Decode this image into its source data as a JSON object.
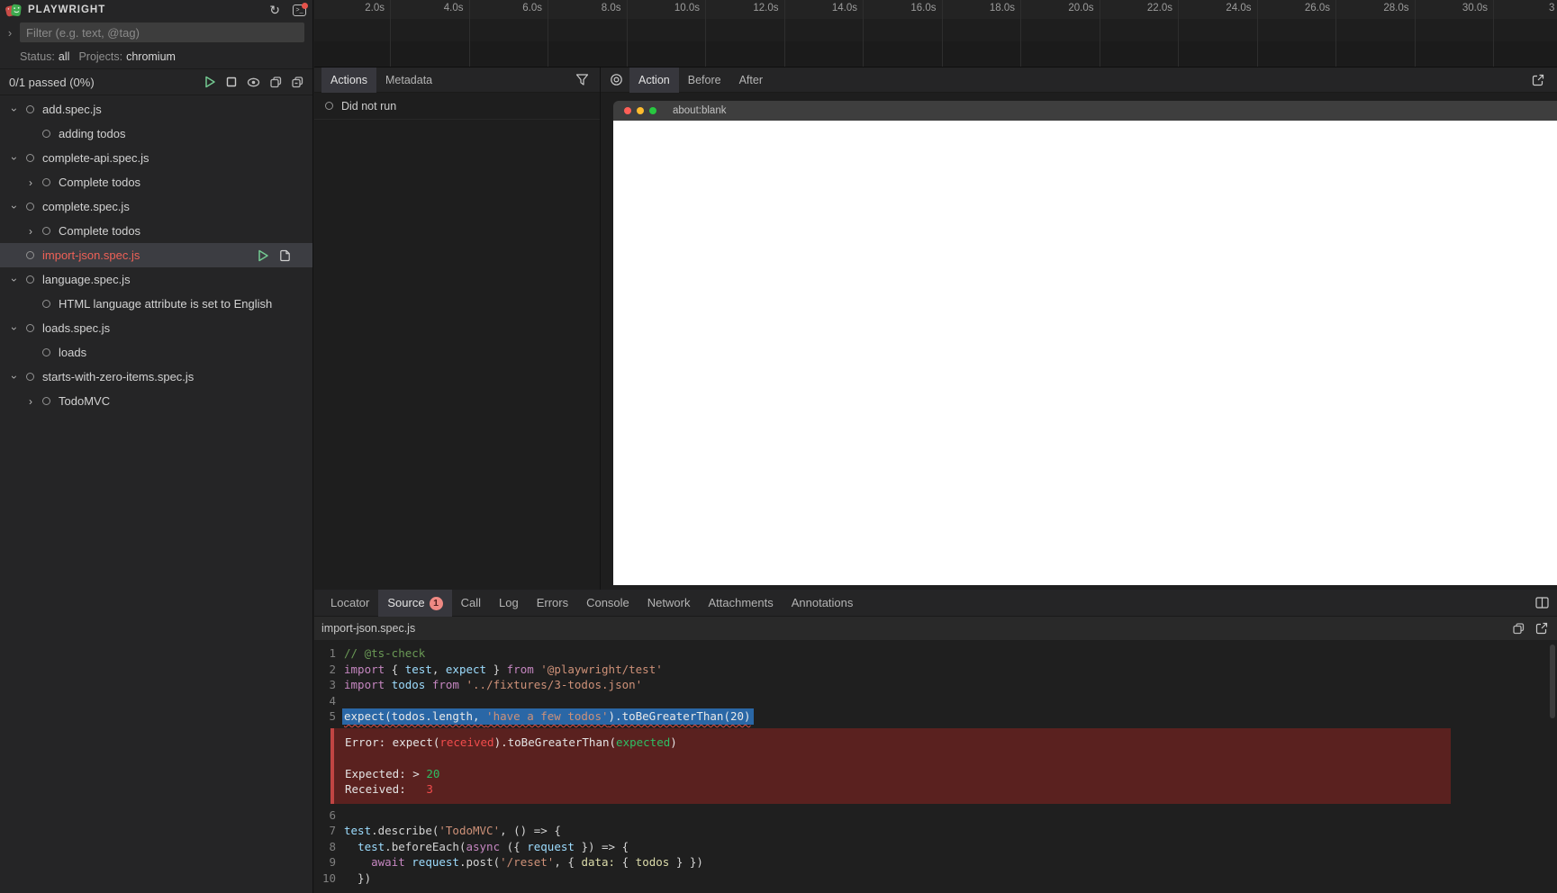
{
  "app": {
    "title": "PLAYWRIGHT"
  },
  "left_panel": {
    "filter_placeholder": "Filter (e.g. text, @tag)",
    "status_label": "Status:",
    "status_value": "all",
    "projects_label": "Projects:",
    "projects_value": "chromium",
    "progress": "0/1 passed (0%)",
    "tree": [
      {
        "label": "add.spec.js",
        "level": 0,
        "chevron": "down"
      },
      {
        "label": "adding todos",
        "level": 1,
        "chevron": null
      },
      {
        "label": "complete-api.spec.js",
        "level": 0,
        "chevron": "down"
      },
      {
        "label": "Complete todos",
        "level": 1,
        "chevron": "right"
      },
      {
        "label": "complete.spec.js",
        "level": 0,
        "chevron": "down"
      },
      {
        "label": "Complete todos",
        "level": 1,
        "chevron": "right"
      },
      {
        "label": "import-json.spec.js",
        "level": 0,
        "chevron": null,
        "selected": true,
        "failed": true,
        "actions": [
          "run",
          "source"
        ]
      },
      {
        "label": "language.spec.js",
        "level": 0,
        "chevron": "down"
      },
      {
        "label": "HTML language attribute is set to English",
        "level": 1,
        "chevron": null
      },
      {
        "label": "loads.spec.js",
        "level": 0,
        "chevron": "down"
      },
      {
        "label": "loads",
        "level": 1,
        "chevron": null
      },
      {
        "label": "starts-with-zero-items.spec.js",
        "level": 0,
        "chevron": "down"
      },
      {
        "label": "TodoMVC",
        "level": 1,
        "chevron": "right"
      }
    ]
  },
  "timeline": {
    "ticks": [
      "2.0s",
      "4.0s",
      "6.0s",
      "8.0s",
      "10.0s",
      "12.0s",
      "14.0s",
      "16.0s",
      "18.0s",
      "20.0s",
      "22.0s",
      "24.0s",
      "26.0s",
      "28.0s",
      "30.0s"
    ],
    "partial_tick": "3"
  },
  "actions_panel": {
    "tabs": [
      {
        "label": "Actions",
        "active": true
      },
      {
        "label": "Metadata",
        "active": false
      }
    ],
    "empty_message": "Did not run"
  },
  "snapshot_panel": {
    "tabs": [
      {
        "label": "Action",
        "active": true
      },
      {
        "label": "Before",
        "active": false
      },
      {
        "label": "After",
        "active": false
      }
    ],
    "browser_title": "about:blank"
  },
  "bottom_panel": {
    "tabs": [
      {
        "label": "Locator"
      },
      {
        "label": "Source",
        "badge": "1",
        "active": true
      },
      {
        "label": "Call"
      },
      {
        "label": "Log"
      },
      {
        "label": "Errors"
      },
      {
        "label": "Console"
      },
      {
        "label": "Network"
      },
      {
        "label": "Attachments"
      },
      {
        "label": "Annotations"
      }
    ],
    "filename": "import-json.spec.js",
    "source": {
      "lines": [
        {
          "num": "1",
          "tokens": [
            {
              "t": "// @ts-check",
              "c": "comment"
            }
          ]
        },
        {
          "num": "2",
          "tokens": [
            {
              "t": "import",
              "c": "kw"
            },
            {
              "t": " { ",
              "c": "p"
            },
            {
              "t": "test",
              "c": "id"
            },
            {
              "t": ", ",
              "c": "p"
            },
            {
              "t": "expect",
              "c": "id"
            },
            {
              "t": " } ",
              "c": "p"
            },
            {
              "t": "from",
              "c": "kw"
            },
            {
              "t": " ",
              "c": "p"
            },
            {
              "t": "'@playwright/test'",
              "c": "str"
            }
          ]
        },
        {
          "num": "3",
          "tokens": [
            {
              "t": "import",
              "c": "kw"
            },
            {
              "t": " ",
              "c": "p"
            },
            {
              "t": "todos",
              "c": "id"
            },
            {
              "t": " ",
              "c": "p"
            },
            {
              "t": "from",
              "c": "kw"
            },
            {
              "t": " ",
              "c": "p"
            },
            {
              "t": "'../fixtures/3-todos.json'",
              "c": "str"
            }
          ]
        },
        {
          "num": "4",
          "tokens": []
        },
        {
          "num": "5",
          "sel": true,
          "tokens": [
            {
              "t": "expect(todos.length, ",
              "c": "sel-p"
            },
            {
              "t": "'have a few todos'",
              "c": "str"
            },
            {
              "t": ").toBeGreaterThan(20)",
              "c": "sel-p"
            }
          ]
        },
        {
          "num": "6",
          "tokens": []
        },
        {
          "num": "7",
          "tokens": [
            {
              "t": "test",
              "c": "id"
            },
            {
              "t": ".describe(",
              "c": "p"
            },
            {
              "t": "'TodoMVC'",
              "c": "str"
            },
            {
              "t": ", () => {",
              "c": "p"
            }
          ]
        },
        {
          "num": "8",
          "tokens": [
            {
              "t": "  ",
              "c": "p"
            },
            {
              "t": "test",
              "c": "id"
            },
            {
              "t": ".beforeEach(",
              "c": "p"
            },
            {
              "t": "async",
              "c": "kw"
            },
            {
              "t": " ({ ",
              "c": "p"
            },
            {
              "t": "request",
              "c": "id"
            },
            {
              "t": " }) => {",
              "c": "p"
            }
          ]
        },
        {
          "num": "9",
          "tokens": [
            {
              "t": "    ",
              "c": "p"
            },
            {
              "t": "await",
              "c": "kw"
            },
            {
              "t": " ",
              "c": "p"
            },
            {
              "t": "request",
              "c": "id"
            },
            {
              "t": ".post(",
              "c": "p"
            },
            {
              "t": "'/reset'",
              "c": "str"
            },
            {
              "t": ", { ",
              "c": "p"
            },
            {
              "t": "data:",
              "c": "prop"
            },
            {
              "t": " { ",
              "c": "p"
            },
            {
              "t": "todos",
              "c": "prop"
            },
            {
              "t": " } })",
              "c": "p"
            }
          ]
        },
        {
          "num": "10",
          "tokens": [
            {
              "t": "  })",
              "c": "p"
            }
          ]
        }
      ],
      "error": {
        "lines": [
          [
            {
              "t": "Error: expect(",
              "c": "w"
            },
            {
              "t": "received",
              "c": "red"
            },
            {
              "t": ").toBeGreaterThan(",
              "c": "w"
            },
            {
              "t": "expected",
              "c": "green"
            },
            {
              "t": ")",
              "c": "w"
            }
          ],
          [],
          [
            {
              "t": "Expected: > ",
              "c": "w"
            },
            {
              "t": "20",
              "c": "green"
            }
          ],
          [
            {
              "t": "Received:   ",
              "c": "w"
            },
            {
              "t": "3",
              "c": "red"
            }
          ]
        ]
      }
    }
  },
  "colors": {
    "failed_test": "#ef6157",
    "run_accent": "#73c991",
    "selection_blue": "#2a67a6",
    "error_background": "#5a211f",
    "error_border": "#c04543",
    "error_received": "#f14c4c",
    "error_expected": "#2fbe64",
    "badge_background": "#ef8983",
    "notification_dot": "#e5534b",
    "traffic_lights": [
      "#ff5f57",
      "#febc2e",
      "#28c840"
    ]
  }
}
